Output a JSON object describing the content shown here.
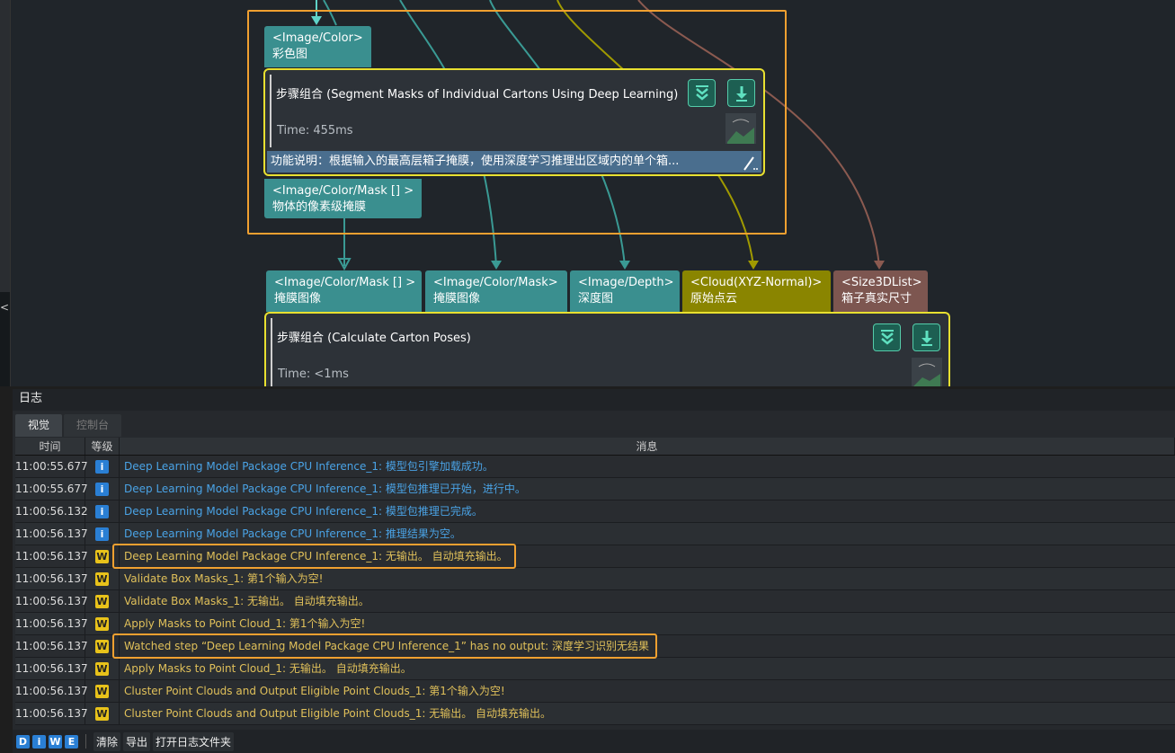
{
  "graph": {
    "group1": {
      "input_port": {
        "type": "<Image/Color>",
        "name": "彩色图"
      },
      "step": {
        "title": "步骤组合 (Segment Masks of Individual Cartons Using Deep Learning)",
        "time": "Time: 455ms",
        "description": "功能说明：根据输入的最高层箱子掩膜，使用深度学习推理出区域内的单个箱..."
      },
      "output_port": {
        "type": "<Image/Color/Mask [] >",
        "name": "物体的像素级掩膜"
      }
    },
    "step2_ports": [
      {
        "type": "<Image/Color/Mask [] >",
        "name": "掩膜图像",
        "color": "#3a8f8f"
      },
      {
        "type": "<Image/Color/Mask>",
        "name": "掩膜图像",
        "color": "#3a8f8f"
      },
      {
        "type": "<Image/Depth>",
        "name": "深度图",
        "color": "#3a8f8f"
      },
      {
        "type": "<Cloud(XYZ-Normal)>",
        "name": "原始点云",
        "color": "#8a8500"
      },
      {
        "type": "<Size3DList>",
        "name": "箱子真实尺寸",
        "color": "#7d5650"
      }
    ],
    "step2": {
      "title": "步骤组合 (Calculate Carton Poses)",
      "time": "Time: <1ms"
    }
  },
  "log": {
    "title": "日志",
    "tabs": [
      {
        "label": "视觉",
        "active": true
      },
      {
        "label": "控制台",
        "active": false
      }
    ],
    "columns": {
      "time": "时间",
      "level": "等级",
      "message": "消息"
    },
    "rows": [
      {
        "time": "11:00:55.677",
        "level": "i",
        "type": "info",
        "message": "Deep Learning Model Package CPU Inference_1: 模型包引擎加载成功。",
        "highlight": false
      },
      {
        "time": "11:00:55.677",
        "level": "i",
        "type": "info",
        "message": "Deep Learning Model Package CPU Inference_1: 模型包推理已开始，进行中。",
        "highlight": false
      },
      {
        "time": "11:00:56.132",
        "level": "i",
        "type": "info",
        "message": "Deep Learning Model Package CPU Inference_1: 模型包推理已完成。",
        "highlight": false
      },
      {
        "time": "11:00:56.137",
        "level": "i",
        "type": "info",
        "message": "Deep Learning Model Package CPU Inference_1: 推理结果为空。",
        "highlight": false
      },
      {
        "time": "11:00:56.137",
        "level": "W",
        "type": "warn",
        "message": "Deep Learning Model Package CPU Inference_1: 无输出。 自动填充输出。",
        "highlight": true
      },
      {
        "time": "11:00:56.137",
        "level": "W",
        "type": "warn",
        "message": "Validate Box Masks_1: 第1个输入为空!",
        "highlight": false
      },
      {
        "time": "11:00:56.137",
        "level": "W",
        "type": "warn",
        "message": "Validate Box Masks_1: 无输出。 自动填充输出。",
        "highlight": false
      },
      {
        "time": "11:00:56.137",
        "level": "W",
        "type": "warn",
        "message": "Apply Masks to Point Cloud_1: 第1个输入为空!",
        "highlight": false
      },
      {
        "time": "11:00:56.137",
        "level": "W",
        "type": "warn",
        "message": "Watched step “Deep Learning Model Package CPU Inference_1” has no output: 深度学习识别无结果",
        "highlight": true
      },
      {
        "time": "11:00:56.137",
        "level": "W",
        "type": "warn",
        "message": "Apply Masks to Point Cloud_1: 无输出。 自动填充输出。",
        "highlight": false
      },
      {
        "time": "11:00:56.137",
        "level": "W",
        "type": "warn",
        "message": "Cluster Point Clouds and Output Eligible Point Clouds_1: 第1个输入为空!",
        "highlight": false
      },
      {
        "time": "11:00:56.137",
        "level": "W",
        "type": "warn",
        "message": "Cluster Point Clouds and Output Eligible Point Clouds_1: 无输出。 自动填充输出。",
        "highlight": false
      }
    ],
    "filters": [
      "D",
      "i",
      "W",
      "E"
    ],
    "actions": {
      "clear": "清除",
      "export": "导出",
      "open_folder": "打开日志文件夹"
    }
  },
  "colors": {
    "highlight": "#f0a030",
    "selected_step": "#e8e030",
    "info": "#2a7fd4",
    "warn": "#e8c21a"
  }
}
